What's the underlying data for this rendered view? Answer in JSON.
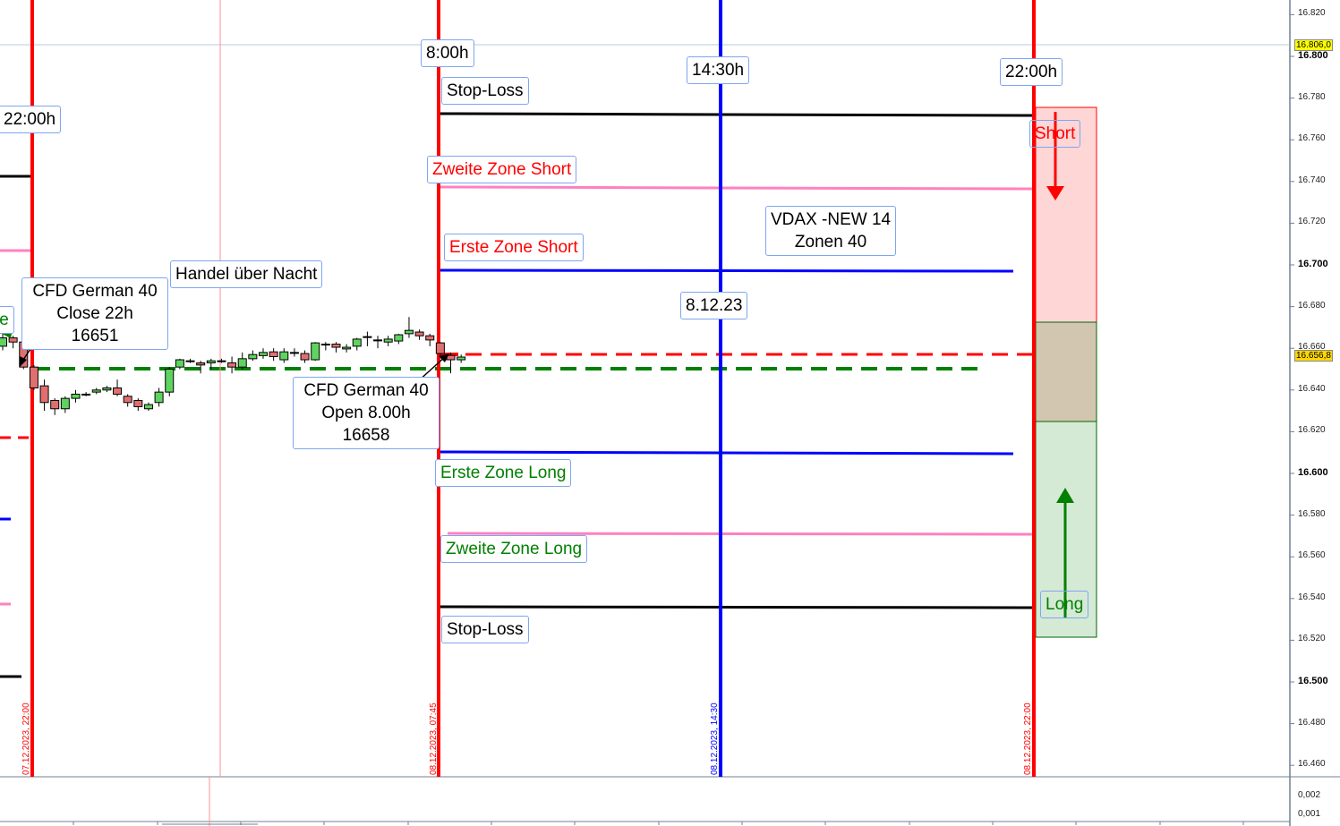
{
  "chart_data": {
    "type": "candlestick",
    "instrument": "CFD German 40",
    "y_axis": {
      "ticks": [
        16820,
        16800,
        16780,
        16760,
        16740,
        16720,
        16700,
        16680,
        16660,
        16640,
        16620,
        16600,
        16580,
        16560,
        16540,
        16520,
        16500,
        16480,
        16460
      ],
      "tick_labels": [
        "16.820",
        "16.800",
        "16.780",
        "16.760",
        "16.740",
        "16.720",
        "16.700",
        "16.680",
        "16.660",
        "16.640",
        "16.620",
        "16.600",
        "16.580",
        "16.560",
        "16.540",
        "16.520",
        "16.500",
        "16.480",
        "16.460"
      ],
      "major": [
        16800,
        16700,
        16600,
        16500
      ],
      "ylim": [
        16457,
        16827
      ]
    },
    "price_tags": [
      {
        "value": 16806.0,
        "label": "16.806,0"
      },
      {
        "value": 16656.8,
        "label": "16.656,8"
      }
    ],
    "lower_pane_ticks": [
      "0,002",
      "0,001"
    ],
    "candles": [
      [
        16661,
        16667,
        16659,
        16665
      ],
      [
        16665,
        16666,
        16660,
        16663
      ],
      [
        16663,
        16665,
        16650,
        16651
      ],
      [
        16651,
        16652,
        16640,
        16641
      ],
      [
        16642,
        16645,
        16630,
        16634
      ],
      [
        16635,
        16636,
        16628,
        16631
      ],
      [
        16631,
        16637,
        16629,
        16636
      ],
      [
        16636,
        16640,
        16634,
        16638
      ],
      [
        16638,
        16639,
        16637,
        16638
      ],
      [
        16639,
        16641,
        16638,
        16640
      ],
      [
        16640,
        16642,
        16639,
        16641
      ],
      [
        16641,
        16645,
        16637,
        16638
      ],
      [
        16637,
        16638,
        16632,
        16634
      ],
      [
        16635,
        16636,
        16630,
        16632
      ],
      [
        16631,
        16634,
        16630,
        16633
      ],
      [
        16634,
        16641,
        16632,
        16639
      ],
      [
        16639,
        16651,
        16637,
        16650
      ],
      [
        16651,
        16655,
        16650,
        16654.5
      ],
      [
        16654,
        16655,
        16653,
        16654
      ],
      [
        16653,
        16654,
        16648,
        16652
      ],
      [
        16653,
        16655,
        16650,
        16654
      ],
      [
        16654,
        16655,
        16653,
        16654
      ],
      [
        16653,
        16656,
        16648,
        16651
      ],
      [
        16651,
        16658,
        16650,
        16655
      ],
      [
        16655,
        16659,
        16654,
        16657
      ],
      [
        16656.5,
        16660,
        16655,
        16658
      ],
      [
        16658.3,
        16660,
        16654,
        16656
      ],
      [
        16654.5,
        16660,
        16653,
        16658.3
      ],
      [
        16658,
        16660,
        16656,
        16658
      ],
      [
        16657.5,
        16659,
        16653,
        16654.5
      ],
      [
        16654.5,
        16663,
        16654,
        16662.6
      ],
      [
        16662,
        16663,
        16659,
        16662
      ],
      [
        16662,
        16663,
        16658,
        16660.5
      ],
      [
        16659.7,
        16662,
        16658,
        16660.5
      ],
      [
        16661,
        16665,
        16659,
        16664.4
      ],
      [
        16665.6,
        16668,
        16661,
        16665.6
      ],
      [
        16664,
        16666,
        16660,
        16664
      ],
      [
        16663,
        16666,
        16661,
        16664.4
      ],
      [
        16663.5,
        16667,
        16662,
        16666.5
      ],
      [
        16667,
        16675,
        16665,
        16668.6
      ],
      [
        16667.8,
        16669,
        16664,
        16666
      ],
      [
        16666,
        16667,
        16661,
        16664
      ],
      [
        16662.6,
        16663,
        16656,
        16657.5
      ],
      [
        16656.6,
        16658,
        16648,
        16654.5
      ],
      [
        16654.5,
        16657,
        16653,
        16655.8
      ]
    ],
    "levels": {
      "stop_loss_short": 16772,
      "zweite_zone_short": 16737,
      "erste_zone_short": 16697.5,
      "open_8h": 16657,
      "close_22h": 16651,
      "erste_zone_long": 16610,
      "zweite_zone_long": 16571,
      "stop_loss_long": 16536
    },
    "vertical_markers": [
      "07.12.2023, 22:00",
      "08.12.2023, 07:45",
      "08.12.2023, 14:30",
      "08.12.2023, 22:00"
    ]
  },
  "labels": {
    "t2200_left": "22:00h",
    "t800": "8:00h",
    "t1430": "14:30h",
    "t2200_right": "22:00h",
    "stop_loss_top": "Stop-Loss",
    "zweite_zone_short": "Zweite Zone Short",
    "erste_zone_short": "Erste Zone Short",
    "vdax_line1": "VDAX -NEW 14",
    "vdax_line2": "Zonen 40",
    "date": "8.12.23",
    "handel": "Handel über Nacht",
    "close_line1": "CFD German 40",
    "close_line2": "Close 22h",
    "close_line3": "16651",
    "open_line1": "CFD German 40",
    "open_line2": "Open 8.00h",
    "open_line3": "16658",
    "erste_zone_long": "Erste Zone Long",
    "zweite_zone_long": "Zweite Zone Long",
    "stop_loss_bottom": "Stop-Loss",
    "short": "Short",
    "long": "Long",
    "left_partial": "te"
  },
  "colors": {
    "bull": "#5fd35f",
    "bear": "#e07070",
    "short_zone": "#ffd6d6",
    "neutral_zone": "#d3c6b0",
    "long_zone": "#d5ead5"
  }
}
